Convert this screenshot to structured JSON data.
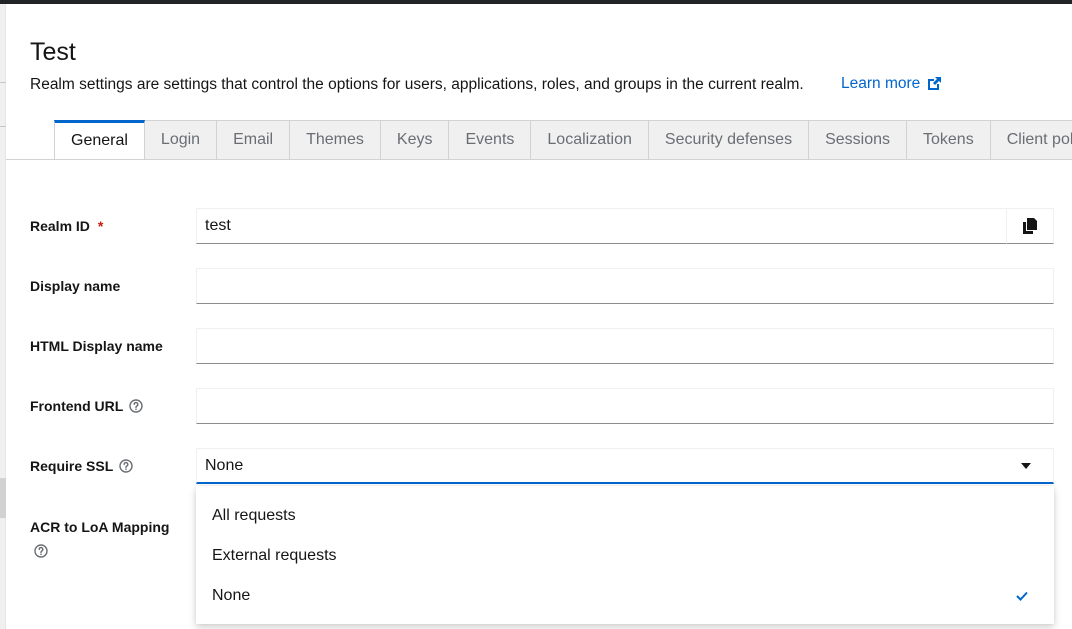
{
  "header": {
    "title": "Test",
    "description": "Realm settings are settings that control the options for users, applications, roles, and groups in the current realm.",
    "learn_more": "Learn more"
  },
  "tabs": [
    {
      "label": "General",
      "active": true
    },
    {
      "label": "Login"
    },
    {
      "label": "Email"
    },
    {
      "label": "Themes"
    },
    {
      "label": "Keys"
    },
    {
      "label": "Events"
    },
    {
      "label": "Localization"
    },
    {
      "label": "Security defenses"
    },
    {
      "label": "Sessions"
    },
    {
      "label": "Tokens"
    },
    {
      "label": "Client polic"
    }
  ],
  "form": {
    "realm_id": {
      "label": "Realm ID",
      "required_mark": "*",
      "value": "test"
    },
    "display_name": {
      "label": "Display name",
      "value": ""
    },
    "html_display_name": {
      "label": "HTML Display name",
      "value": ""
    },
    "frontend_url": {
      "label": "Frontend URL",
      "value": ""
    },
    "require_ssl": {
      "label": "Require SSL",
      "value": "None"
    },
    "acr_mapping": {
      "label": "ACR to LoA Mapping"
    }
  },
  "dropdown": {
    "options": [
      "All requests",
      "External requests",
      "None"
    ],
    "selected": "None"
  },
  "colors": {
    "accent": "#0066cc",
    "required": "#c9190b",
    "top_bar": "#212427"
  },
  "icons": [
    "external-link-icon",
    "copy-icon",
    "help-icon",
    "caret-down-icon",
    "check-icon"
  ]
}
